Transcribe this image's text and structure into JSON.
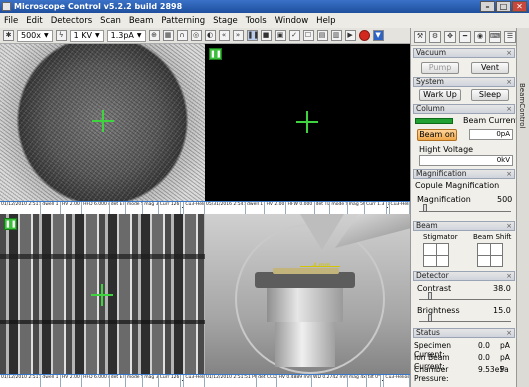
{
  "window": {
    "title": "Microscope Control v5.2.2 build 2898"
  },
  "menu": [
    "File",
    "Edit",
    "Detectors",
    "Scan",
    "Beam",
    "Patterning",
    "Stage",
    "Tools",
    "Window",
    "Help"
  ],
  "toolbar": {
    "magnification": "500x",
    "voltage": "1 KV",
    "current": "1.3pA"
  },
  "quad1": {
    "info": [
      "01/12/2010 2:51:51 PM",
      "dwell 1 µs",
      "HV 2.00 kV",
      "HFD 6.000 mm",
      "det ETD",
      "mode SE",
      "mag 39",
      "Curr 126 nA",
      "10µm",
      "Cu3-Helios"
    ]
  },
  "quad2": {
    "info": [
      "05/31/2016 2:54:35 PM",
      "dwell 1 µs",
      "HV 2.00 kV",
      "HFW 0.000 mm",
      "det TLD",
      "mode SE",
      "mag 500",
      "Curr 1.3 pA",
      "10µm",
      "Cu3-Helios"
    ]
  },
  "quad3": {
    "info": [
      "01/12/2010 2:51:51 PM",
      "dwell 1 µs",
      "HV 2.00 kV",
      "HFD 6.000 mm",
      "det ETD",
      "mode SE",
      "mag 39",
      "Curr 126 nA",
      "10µm",
      "Cu3-Helios"
    ]
  },
  "quad4": {
    "scale_label": "4 mm",
    "info": [
      "01/12/2010 2:51:51 PM",
      "det CCD",
      "HV 0.4889 mm",
      "WD 0.2742 mm",
      "mag 4x",
      "tilt 0°",
      "10µm",
      "Cu3-Helios"
    ]
  },
  "panel": {
    "sidetab": "BeamControl",
    "vacuum": {
      "header": "Vacuum",
      "pump": "Pump",
      "vent": "Vent"
    },
    "system": {
      "header": "System",
      "warm_up": "Wark Up",
      "sleep": "Sleep"
    },
    "column": {
      "header": "Column",
      "beam_current_label": "Beam Current",
      "beam_on": "Beam on",
      "beam_current_value": "0pA",
      "voltage_label": "Hight Voltage",
      "voltage_value": "0kV"
    },
    "magnification": {
      "header": "Magnification",
      "couple": "Copule Magnification",
      "label": "Magnification",
      "value": "500",
      "slider_fraction": 0.05
    },
    "beam": {
      "header": "Beam",
      "stigmator": "Stigmator",
      "beam_shift": "Beam Shift"
    },
    "detector": {
      "header": "Detector",
      "contrast_label": "Contrast",
      "contrast_value": "38.0",
      "brightness_label": "Brightness",
      "brightness_value": "15.0",
      "contrast_fraction": 0.1,
      "brightness_fraction": 0.1
    },
    "status": {
      "header": "Status",
      "rows": [
        {
          "k": "Specimen Current:",
          "v": "0.0",
          "u": "pA"
        },
        {
          "k": "Ion Beam Current:",
          "v": "0.0",
          "u": "pA"
        },
        {
          "k": "Chamber Pressure:",
          "v": "9.53e5",
          "u": "Pa"
        }
      ]
    }
  }
}
